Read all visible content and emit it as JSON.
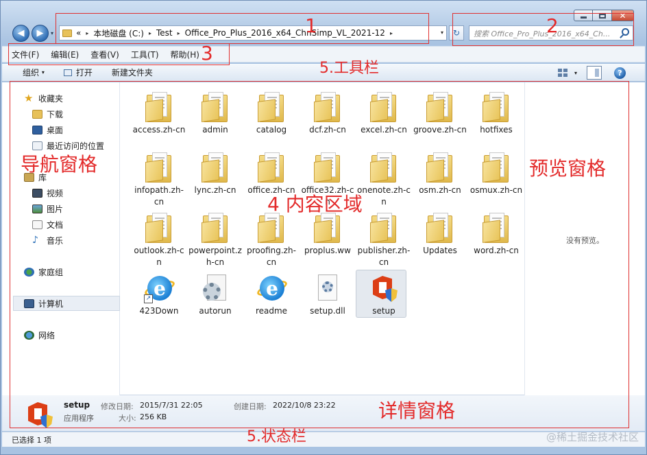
{
  "window": {
    "close_glyph": "✕"
  },
  "nav": {
    "back": "◀",
    "forward": "▶",
    "dropdown": "▾"
  },
  "address": {
    "chevron": "«",
    "segments": [
      "本地磁盘 (C:)",
      "Test",
      "Office_Pro_Plus_2016_x64_ChnSimp_VL_2021-12"
    ],
    "separator": "▸",
    "dropdown": "▾",
    "refresh": "↻"
  },
  "search": {
    "placeholder": "搜索 Office_Pro_Plus_2016_x64_Ch..."
  },
  "menu": [
    "文件(F)",
    "编辑(E)",
    "查看(V)",
    "工具(T)",
    "帮助(H)"
  ],
  "toolbar": {
    "organize": "组织",
    "organize_arrow": "▾",
    "open": "打开",
    "new_folder": "新建文件夹",
    "views_arrow": "▾",
    "help": "?"
  },
  "navpane": {
    "favorites": "收藏夹",
    "fav_items": [
      "下载",
      "桌面",
      "最近访问的位置"
    ],
    "libraries": "库",
    "lib_items": [
      "视频",
      "图片",
      "文档",
      "音乐"
    ],
    "homegroup": "家庭组",
    "computer": "计算机",
    "network": "网络"
  },
  "files": [
    {
      "name": "access.zh-cn",
      "kind": "folder"
    },
    {
      "name": "admin",
      "kind": "folder"
    },
    {
      "name": "catalog",
      "kind": "folder"
    },
    {
      "name": "dcf.zh-cn",
      "kind": "folder"
    },
    {
      "name": "excel.zh-cn",
      "kind": "folder"
    },
    {
      "name": "groove.zh-cn",
      "kind": "folder"
    },
    {
      "name": "hotfixes",
      "kind": "folder"
    },
    {
      "name": "infopath.zh-cn",
      "kind": "folder"
    },
    {
      "name": "lync.zh-cn",
      "kind": "folder"
    },
    {
      "name": "office.zh-cn",
      "kind": "folder"
    },
    {
      "name": "office32.zh-cn",
      "kind": "folder"
    },
    {
      "name": "onenote.zh-cn",
      "kind": "folder"
    },
    {
      "name": "osm.zh-cn",
      "kind": "folder"
    },
    {
      "name": "osmux.zh-cn",
      "kind": "folder"
    },
    {
      "name": "outlook.zh-cn",
      "kind": "folder"
    },
    {
      "name": "powerpoint.zh-cn",
      "kind": "folder"
    },
    {
      "name": "proofing.zh-cn",
      "kind": "folder"
    },
    {
      "name": "proplus.ww",
      "kind": "folder"
    },
    {
      "name": "publisher.zh-cn",
      "kind": "folder"
    },
    {
      "name": "Updates",
      "kind": "folder"
    },
    {
      "name": "word.zh-cn",
      "kind": "folder"
    },
    {
      "name": "423Down",
      "kind": "ie-shortcut"
    },
    {
      "name": "autorun",
      "kind": "config"
    },
    {
      "name": "readme",
      "kind": "ie"
    },
    {
      "name": "setup.dll",
      "kind": "dll"
    },
    {
      "name": "setup",
      "kind": "office",
      "selected": true
    }
  ],
  "preview": {
    "empty_text": "没有预览。"
  },
  "details": {
    "name": "setup",
    "type": "应用程序",
    "modified_label": "修改日期:",
    "modified_value": "2015/7/31 22:05",
    "created_label": "创建日期:",
    "created_value": "2022/10/8 23:22",
    "size_label": "大小:",
    "size_value": "256 KB"
  },
  "status": {
    "text": "已选择 1 项"
  },
  "annotations": {
    "n1": "1",
    "n2": "2",
    "n3": "3",
    "toolbar": "5.工具栏",
    "navpane": "导航窗格",
    "content": "4  内容区域",
    "preview": "预览窗格",
    "details": "详情窗格",
    "statusbar": "5.状态栏"
  },
  "watermark": "@稀土掘金技术社区",
  "colors": {
    "annotation": "#e32a2a",
    "folder": "#e8c45a",
    "accent": "#2f6eb5"
  }
}
